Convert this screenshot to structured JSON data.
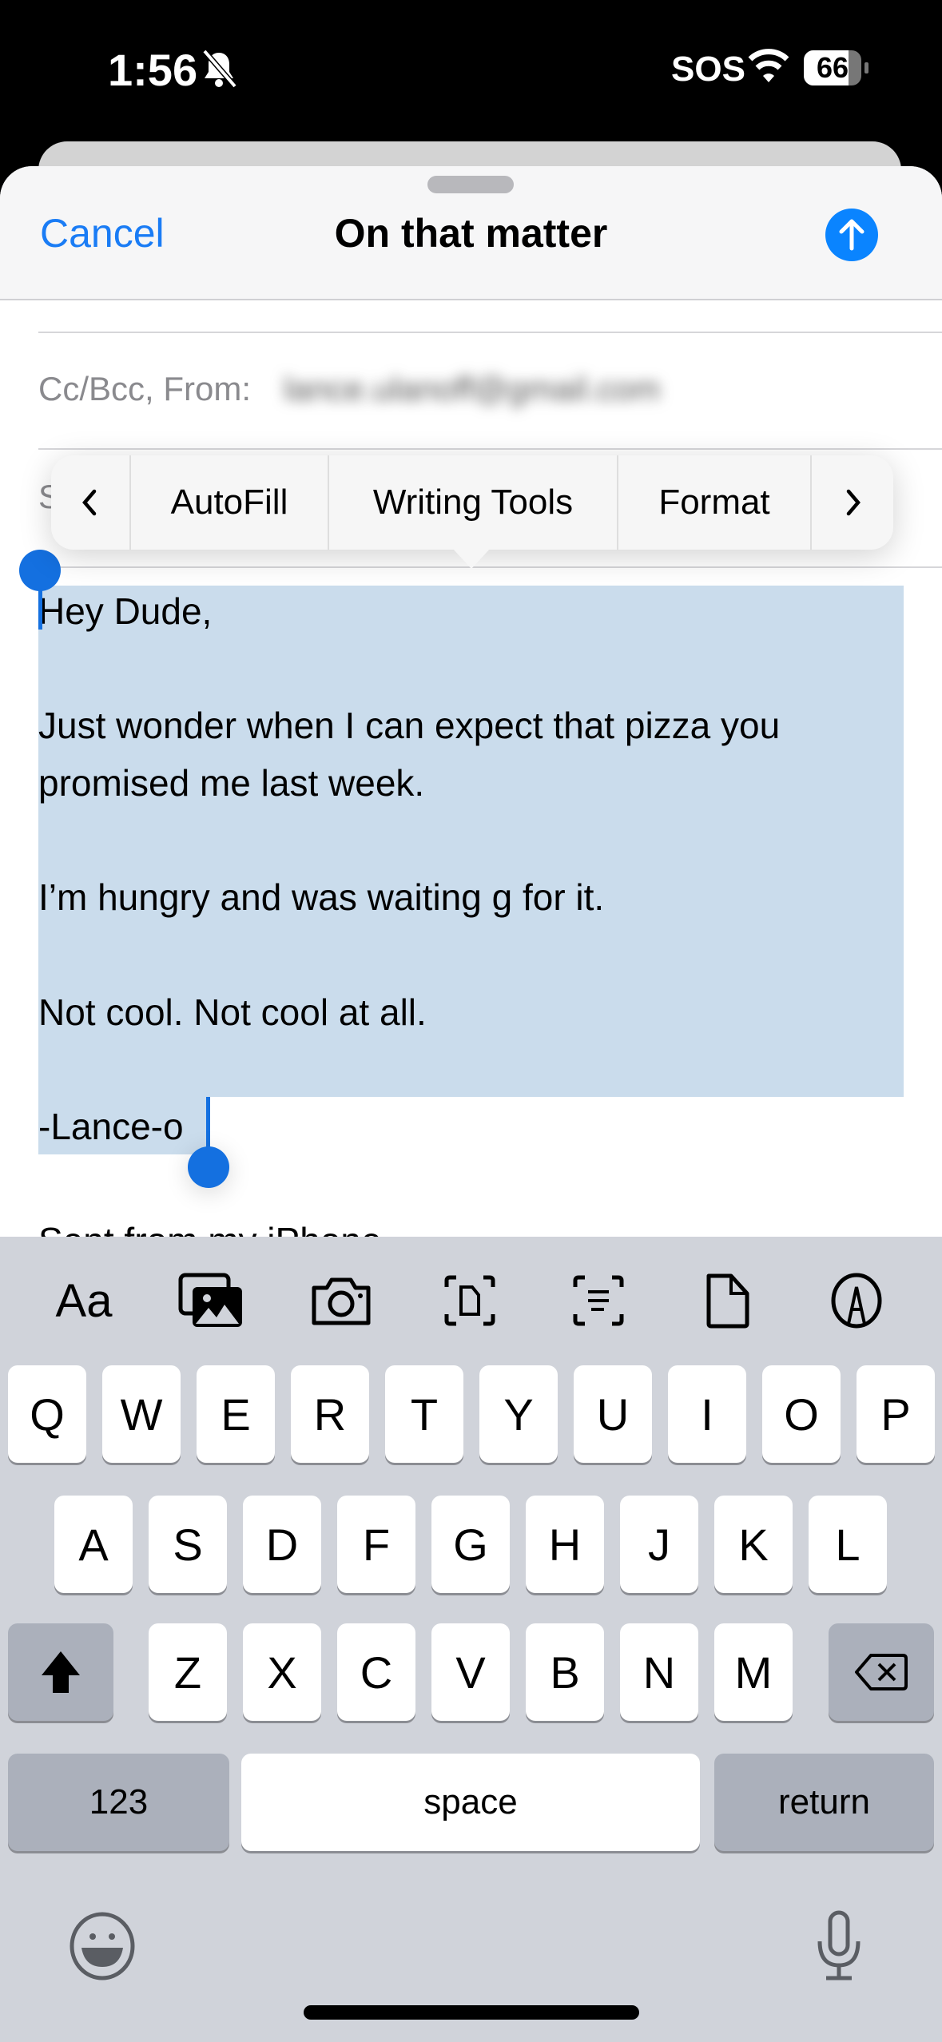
{
  "status_bar": {
    "time": "1:56",
    "carrier": "SOS",
    "battery": "66",
    "icons": [
      "bell-slash-icon",
      "wifi-icon",
      "battery-icon"
    ]
  },
  "header": {
    "cancel": "Cancel",
    "title": "On that matter",
    "send_icon": "arrow-up-circle-icon"
  },
  "fields": {
    "cc_bcc_from": "Cc/Bcc, From:",
    "from_value_blurred": "lance.ulanoff@gmail.com",
    "subject_stub": "S"
  },
  "edit_menu": {
    "prev_icon": "chevron-left-icon",
    "items": [
      "AutoFill",
      "Writing Tools",
      "Format"
    ],
    "next_icon": "chevron-right-icon"
  },
  "body": {
    "lines": [
      "Hey Dude,",
      "Just wonder when I can expect that pizza you",
      "promised me last week.",
      "I’m hungry and was waiting g for it.",
      "Not cool. Not cool at all.",
      "-Lance-o",
      "Sent from my iPhone"
    ]
  },
  "keyboard": {
    "toolbar": [
      "Aa",
      "photos-icon",
      "camera-icon",
      "scan-document-icon",
      "scan-text-icon",
      "document-icon",
      "markup-icon"
    ],
    "row1": [
      "Q",
      "W",
      "E",
      "R",
      "T",
      "Y",
      "U",
      "I",
      "O",
      "P"
    ],
    "row2": [
      "A",
      "S",
      "D",
      "F",
      "G",
      "H",
      "J",
      "K",
      "L"
    ],
    "row3": [
      "Z",
      "X",
      "C",
      "V",
      "B",
      "N",
      "M"
    ],
    "numbers": "123",
    "space": "space",
    "return": "return",
    "colors": {
      "background": "#d0d3da",
      "dark_key": "#abb0bb",
      "accent": "#0a84ff",
      "selection": "#cadcec"
    }
  }
}
